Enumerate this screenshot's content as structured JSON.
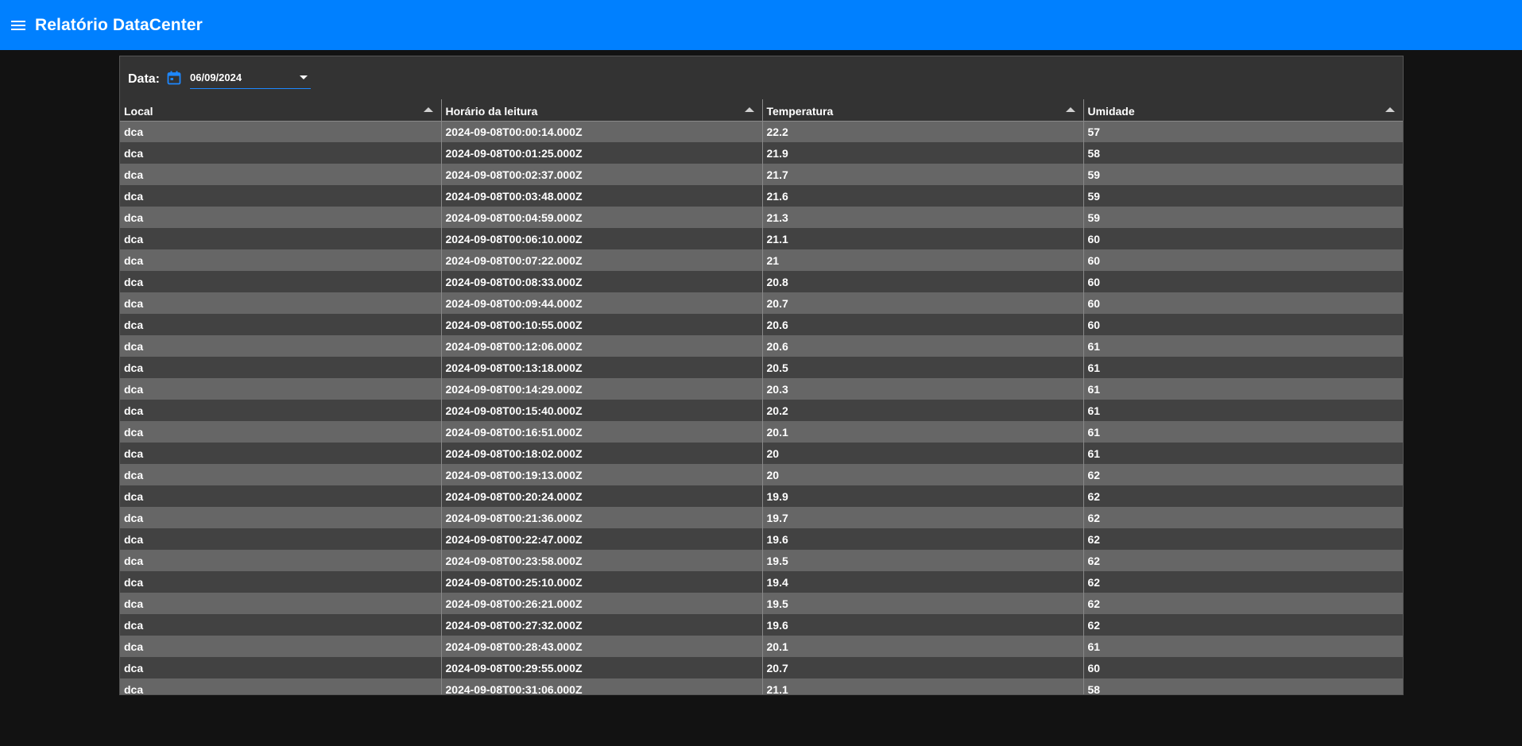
{
  "app": {
    "title": "Relatório DataCenter"
  },
  "filter": {
    "label": "Data:",
    "date_value": "06/09/2024"
  },
  "table": {
    "columns": [
      "Local",
      "Horário da leitura",
      "Temperatura",
      "Umidade"
    ],
    "rows": [
      [
        "dca",
        "2024-09-08T00:00:14.000Z",
        "22.2",
        "57"
      ],
      [
        "dca",
        "2024-09-08T00:01:25.000Z",
        "21.9",
        "58"
      ],
      [
        "dca",
        "2024-09-08T00:02:37.000Z",
        "21.7",
        "59"
      ],
      [
        "dca",
        "2024-09-08T00:03:48.000Z",
        "21.6",
        "59"
      ],
      [
        "dca",
        "2024-09-08T00:04:59.000Z",
        "21.3",
        "59"
      ],
      [
        "dca",
        "2024-09-08T00:06:10.000Z",
        "21.1",
        "60"
      ],
      [
        "dca",
        "2024-09-08T00:07:22.000Z",
        "21",
        "60"
      ],
      [
        "dca",
        "2024-09-08T00:08:33.000Z",
        "20.8",
        "60"
      ],
      [
        "dca",
        "2024-09-08T00:09:44.000Z",
        "20.7",
        "60"
      ],
      [
        "dca",
        "2024-09-08T00:10:55.000Z",
        "20.6",
        "60"
      ],
      [
        "dca",
        "2024-09-08T00:12:06.000Z",
        "20.6",
        "61"
      ],
      [
        "dca",
        "2024-09-08T00:13:18.000Z",
        "20.5",
        "61"
      ],
      [
        "dca",
        "2024-09-08T00:14:29.000Z",
        "20.3",
        "61"
      ],
      [
        "dca",
        "2024-09-08T00:15:40.000Z",
        "20.2",
        "61"
      ],
      [
        "dca",
        "2024-09-08T00:16:51.000Z",
        "20.1",
        "61"
      ],
      [
        "dca",
        "2024-09-08T00:18:02.000Z",
        "20",
        "61"
      ],
      [
        "dca",
        "2024-09-08T00:19:13.000Z",
        "20",
        "62"
      ],
      [
        "dca",
        "2024-09-08T00:20:24.000Z",
        "19.9",
        "62"
      ],
      [
        "dca",
        "2024-09-08T00:21:36.000Z",
        "19.7",
        "62"
      ],
      [
        "dca",
        "2024-09-08T00:22:47.000Z",
        "19.6",
        "62"
      ],
      [
        "dca",
        "2024-09-08T00:23:58.000Z",
        "19.5",
        "62"
      ],
      [
        "dca",
        "2024-09-08T00:25:10.000Z",
        "19.4",
        "62"
      ],
      [
        "dca",
        "2024-09-08T00:26:21.000Z",
        "19.5",
        "62"
      ],
      [
        "dca",
        "2024-09-08T00:27:32.000Z",
        "19.6",
        "62"
      ],
      [
        "dca",
        "2024-09-08T00:28:43.000Z",
        "20.1",
        "61"
      ],
      [
        "dca",
        "2024-09-08T00:29:55.000Z",
        "20.7",
        "60"
      ],
      [
        "dca",
        "2024-09-08T00:31:06.000Z",
        "21.1",
        "58"
      ]
    ]
  },
  "colors": {
    "appbar": "#0080ff",
    "background": "#121212",
    "panel": "#333333",
    "row_light": "#666666",
    "row_dark": "#424242",
    "accent": "#1e88ff"
  },
  "icons": {
    "menu": "menu-icon",
    "calendar": "calendar-icon",
    "dropdown": "chevron-down-icon",
    "sort": "sort-ascending-icon"
  }
}
